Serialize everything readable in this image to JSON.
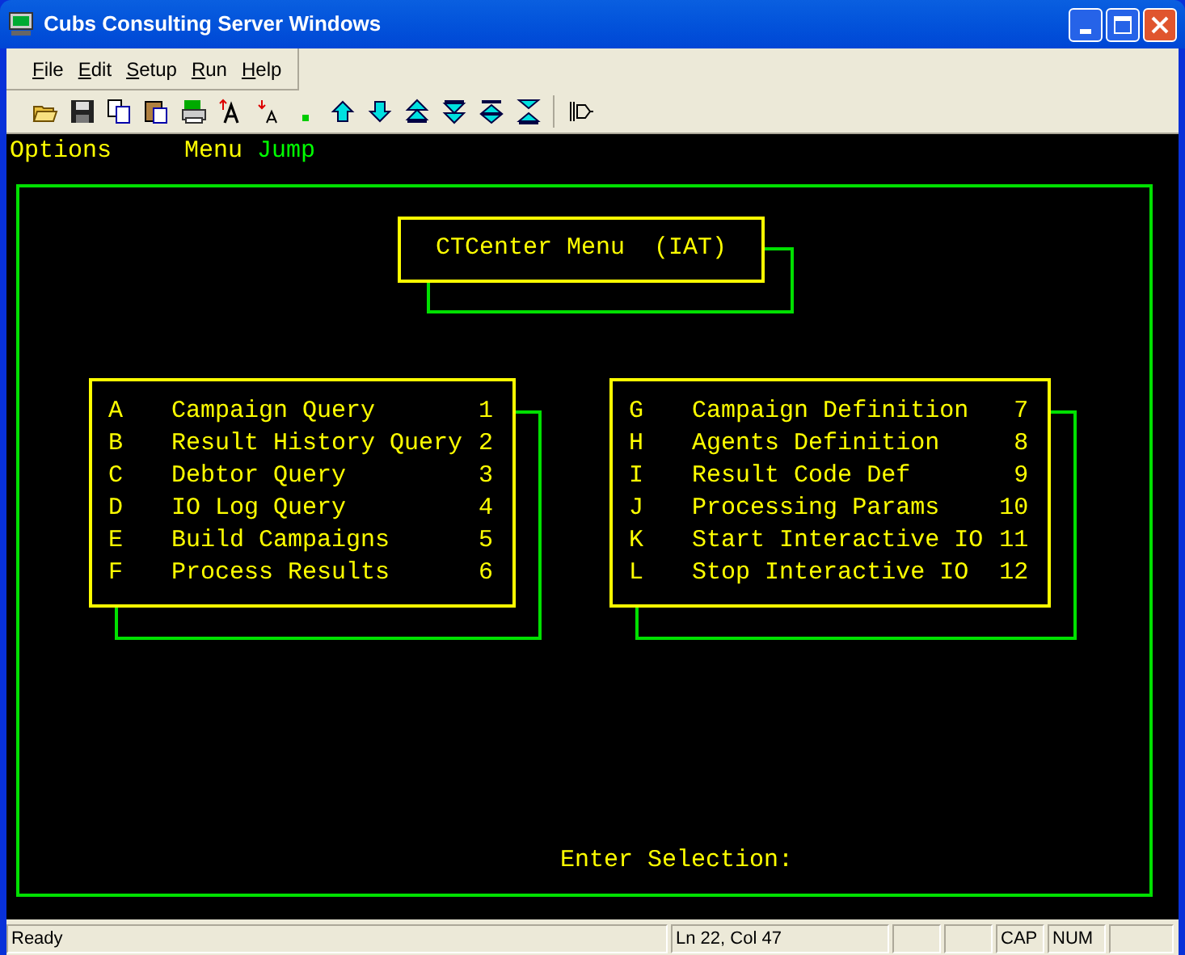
{
  "window": {
    "title": "Cubs Consulting Server Windows"
  },
  "menu_bar": [
    {
      "label": "File"
    },
    {
      "label": "Edit"
    },
    {
      "label": "Setup"
    },
    {
      "label": "Run"
    },
    {
      "label": "Help"
    }
  ],
  "terminal": {
    "top_line": [
      {
        "text": "Options",
        "color": "#ffff00"
      },
      {
        "text": "Menu",
        "color": "#ffff00"
      },
      {
        "text": "Jump",
        "color": "#00ff00"
      }
    ],
    "menu_title": "CTCenter Menu  (IAT)",
    "left_panel": [
      {
        "key": "A",
        "label": "Campaign Query",
        "number": "1"
      },
      {
        "key": "B",
        "label": "Result History Query",
        "number": "2"
      },
      {
        "key": "C",
        "label": "Debtor Query",
        "number": "3"
      },
      {
        "key": "D",
        "label": "IO Log Query",
        "number": "4"
      },
      {
        "key": "E",
        "label": "Build Campaigns",
        "number": "5"
      },
      {
        "key": "F",
        "label": "Process Results",
        "number": "6"
      }
    ],
    "right_panel": [
      {
        "key": "G",
        "label": "Campaign Definition",
        "number": "7"
      },
      {
        "key": "H",
        "label": "Agents Definition",
        "number": "8"
      },
      {
        "key": "I",
        "label": "Result Code Def",
        "number": "9"
      },
      {
        "key": "J",
        "label": "Processing Params",
        "number": "10"
      },
      {
        "key": "K",
        "label": "Start Interactive IO",
        "number": "11"
      },
      {
        "key": "L",
        "label": "Stop Interactive IO",
        "number": "12"
      }
    ],
    "prompt": "Enter Selection:"
  },
  "status_bar": {
    "message": "Ready",
    "position": "Ln 22, Col 47",
    "caps": "CAP",
    "num": "NUM"
  }
}
